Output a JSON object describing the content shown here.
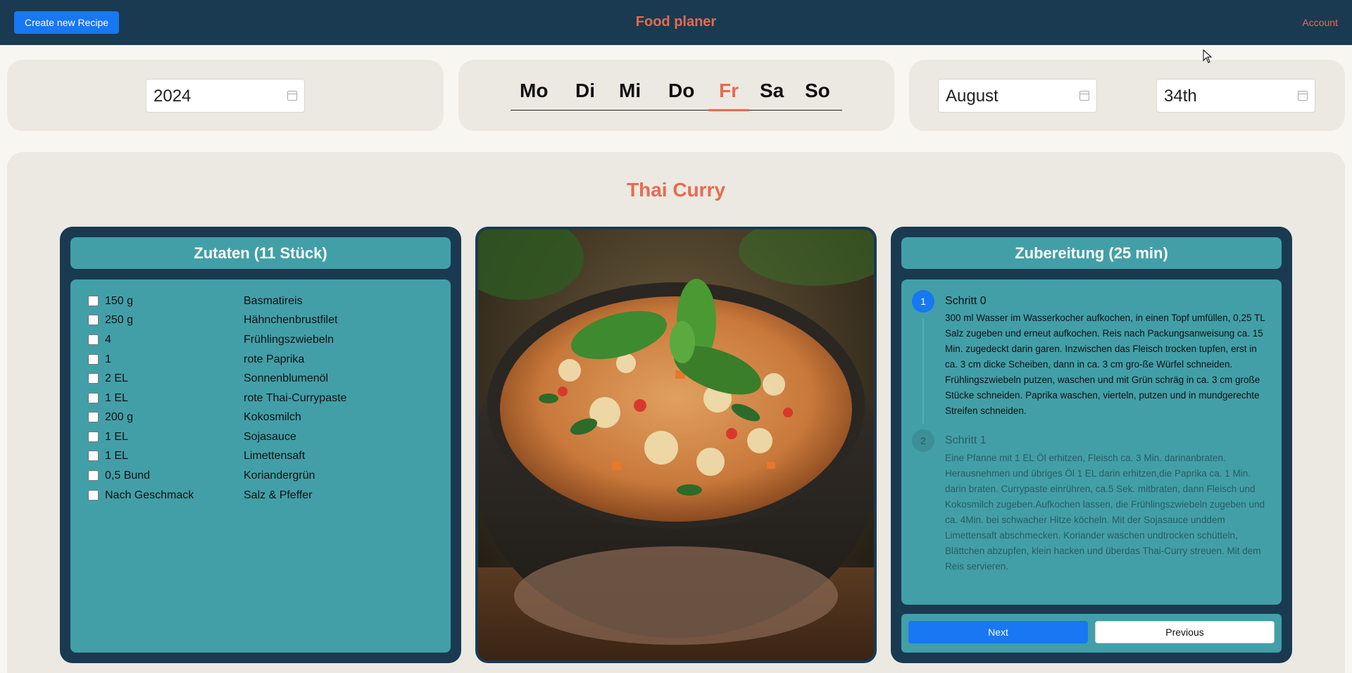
{
  "topbar": {
    "create_button": "Create new Recipe",
    "title": "Food planer",
    "account": "Account"
  },
  "selectors": {
    "year": "2024",
    "days": [
      "Mo",
      "Di",
      "Mi",
      "Do",
      "Fr",
      "Sa",
      "So"
    ],
    "active_day": "Fr",
    "month": "August",
    "week": "34th"
  },
  "recipe": {
    "title": "Thai Curry",
    "ingredients_header": "Zutaten (11 Stück)",
    "ingredients": [
      {
        "qty": "150 g",
        "name": "Basmatireis"
      },
      {
        "qty": "250 g",
        "name": "Hähnchenbrustfilet"
      },
      {
        "qty": "4",
        "name": "Frühlingszwiebeln"
      },
      {
        "qty": "1",
        "name": "rote Paprika"
      },
      {
        "qty": "2 EL",
        "name": "Sonnenblumenöl"
      },
      {
        "qty": "1 EL",
        "name": "rote Thai-Currypaste"
      },
      {
        "qty": "200 g",
        "name": "Kokosmilch"
      },
      {
        "qty": "1 EL",
        "name": "Sojasauce"
      },
      {
        "qty": "1 EL",
        "name": "Limettensaft"
      },
      {
        "qty": "0,5 Bund",
        "name": "Koriandergrün"
      },
      {
        "qty": "Nach Geschmack",
        "name": "Salz & Pfeffer"
      }
    ],
    "steps_header": "Zubereitung (25 min)",
    "steps": [
      {
        "number": "1",
        "title": "Schritt 0",
        "text": "300 ml Wasser im Wasserkocher aufkochen, in einen Topf umfüllen, 0,25 TL Salz zugeben und erneut aufkochen. Reis nach Packungsanweisung ca. 15 Min. zugedeckt darin garen. Inzwischen das Fleisch trocken tupfen, erst in ca. 3 cm dicke Scheiben, dann in ca. 3 cm gro-ße Würfel schneiden. Frühlingszwiebeln putzen, waschen und mit Grün schräg in ca. 3 cm große Stücke schneiden. Paprika waschen, vierteln, putzen und in mundgerechte Streifen schneiden."
      },
      {
        "number": "2",
        "title": "Schritt 1",
        "text": "Eine Pfanne mit 1 EL Öl erhitzen, Fleisch ca. 3 Min. darinanbraten. Herausnehmen und übriges Öl 1 EL darin erhitzen,die Paprika ca. 1 Min. darin braten. Currypaste einrühren, ca.5 Sek. mitbraten, dann Fleisch und Kokosmilch zugeben.Aufkochen lassen, die Frühlingszwiebeln zugeben und ca. 4Min. bei schwacher Hitze köcheln. Mit der Sojasauce unddem Limettensaft abschmecken. Koriander waschen undtrocken schütteln, Blättchen abzupfen, klein hacken und überdas Thai-Curry streuen. Mit dem Reis servieren."
      }
    ],
    "next_label": "Next",
    "previous_label": "Previous"
  },
  "colors": {
    "navy": "#1a3a52",
    "teal": "#429fa8",
    "accent": "#e86a4f",
    "primary_button": "#1877f2",
    "panel": "#ebe9e1"
  }
}
